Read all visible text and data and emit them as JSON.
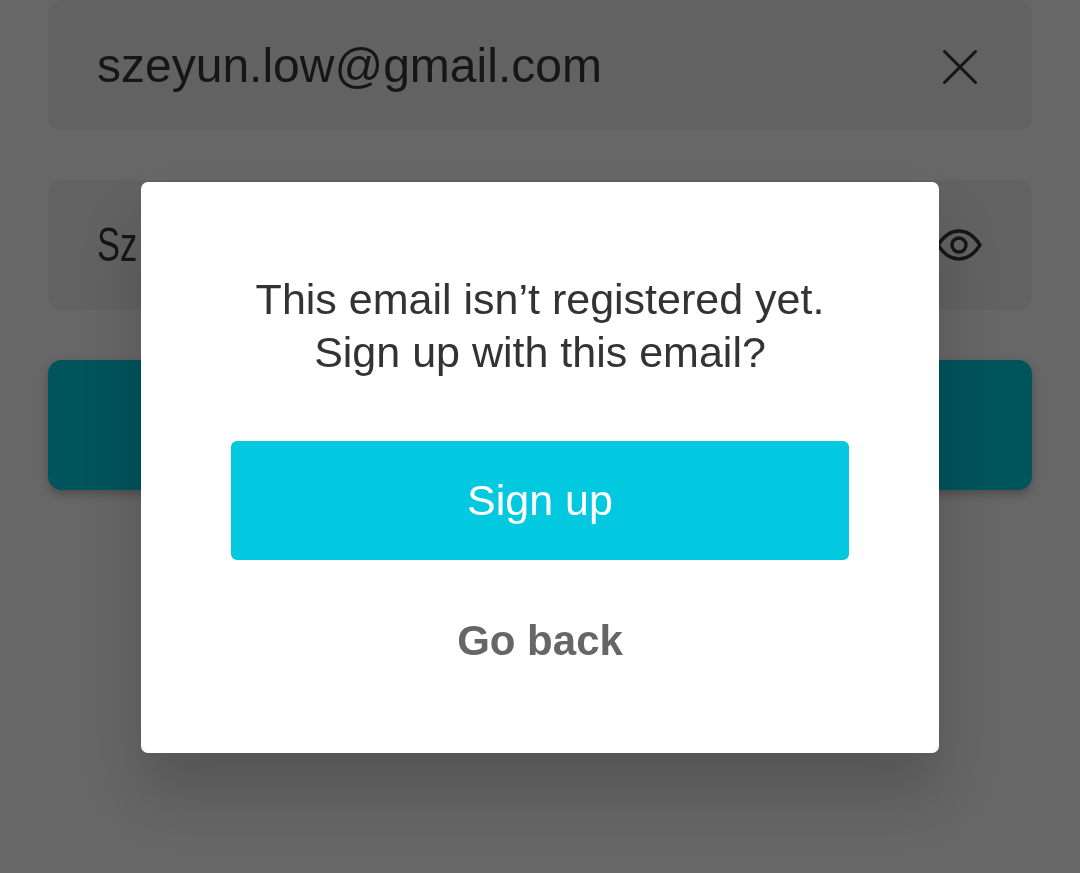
{
  "email_field": {
    "value": "szeyun.low@gmail.com"
  },
  "password_field": {
    "value": "Sz"
  },
  "dialog": {
    "message": "This email isn’t registered yet.\nSign up with this email?",
    "confirm_button": "Sign up",
    "cancel_button": "Go back"
  }
}
